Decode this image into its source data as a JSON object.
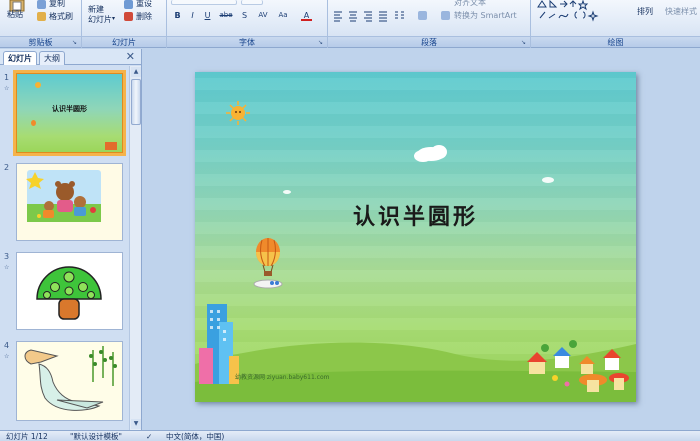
{
  "ribbon": {
    "clipboard": {
      "paste_label": "粘贴",
      "copy_label": "复制",
      "format_painter_label": "格式刷",
      "group_label": "剪贴板"
    },
    "slides": {
      "new_slide_label": "新建\n幻灯片",
      "reset_label": "重设",
      "delete_label": "删除",
      "group_label": "幻灯片"
    },
    "font": {
      "group_label": "字体",
      "buttons": [
        "B",
        "I",
        "U",
        "abe",
        "S",
        "AV",
        "Aa",
        "A"
      ]
    },
    "paragraph": {
      "group_label": "段落",
      "align_text_label": "对齐文本",
      "convert_smartart_label": "转换为 SmartArt"
    },
    "drawing": {
      "group_label": "绘图",
      "arrange_label": "排列",
      "quick_styles_label": "快速样式"
    }
  },
  "left_pane": {
    "tabs": [
      "幻灯片",
      "大纲"
    ],
    "close_icon": "close-icon",
    "thumbnails": [
      {
        "number": "1",
        "title": "认识半圆形"
      },
      {
        "number": "2"
      },
      {
        "number": "3"
      },
      {
        "number": "4"
      }
    ]
  },
  "slide": {
    "title": "认识半圆形",
    "watermark": "幼教资源网 ziyuan.baby611.com"
  },
  "statusbar": {
    "slide_info": "幻灯片 1/12",
    "theme": "\"默认设计模板\"",
    "language": "中文(简体，中国)"
  },
  "colors": {
    "selection": "#f5b34a",
    "ribbon_text": "#15428b",
    "workspace": "#bfd3ec"
  }
}
